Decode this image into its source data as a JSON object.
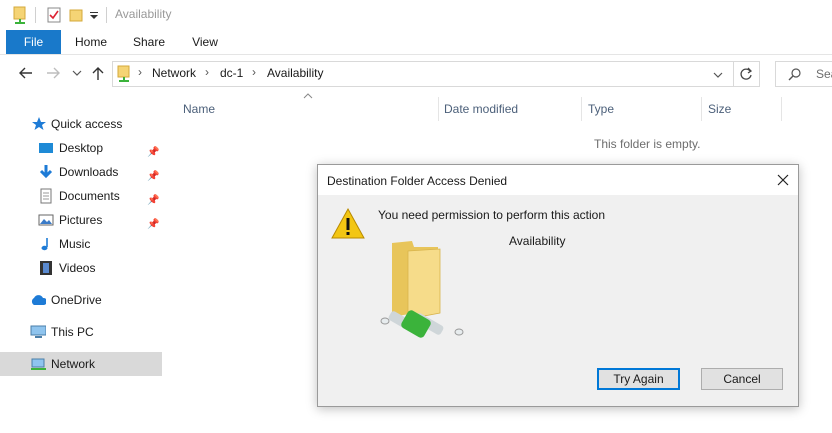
{
  "window": {
    "title": "Availability"
  },
  "ribbon": {
    "tabs": [
      "File",
      "Home",
      "Share",
      "View"
    ]
  },
  "address": {
    "crumbs": [
      "Network",
      "dc-1",
      "Availability"
    ],
    "search_placeholder": "Search"
  },
  "nav": {
    "quick_access": "Quick access",
    "desktop": "Desktop",
    "downloads": "Downloads",
    "documents": "Documents",
    "pictures": "Pictures",
    "music": "Music",
    "videos": "Videos",
    "onedrive": "OneDrive",
    "this_pc": "This PC",
    "network": "Network"
  },
  "columns": {
    "name": "Name",
    "date_modified": "Date modified",
    "type": "Type",
    "size": "Size"
  },
  "content": {
    "empty_message": "This folder is empty."
  },
  "dialog": {
    "title": "Destination Folder Access Denied",
    "message": "You need permission to perform this action",
    "folder_name": "Availability",
    "try_again": "Try Again",
    "cancel": "Cancel"
  },
  "colors": {
    "accent": "#1979ca",
    "selected": "#d9d9d9",
    "folder": "#f5d475",
    "warning": "#f3c613",
    "network_pipe": "#3bb33b"
  }
}
